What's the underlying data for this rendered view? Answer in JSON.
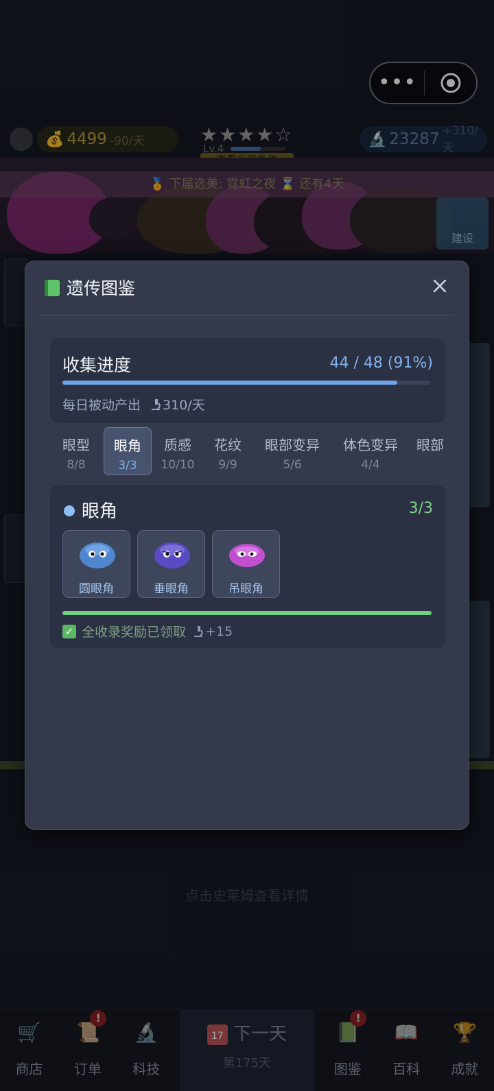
{
  "topbar": {
    "coins": "4499",
    "coins_rate": "-90/天",
    "stars": "★★★★☆",
    "level": "Lv.4",
    "upgrade_label": "查看升级条件",
    "research": "23287",
    "research_rate": "+310/天",
    "event_text": "🏅 下届选美: 霓虹之夜   ⌛ 还有4天",
    "build_label": "建设"
  },
  "hint": "点击史莱姆查看详情",
  "modal": {
    "title": "遗传图鉴",
    "progress": {
      "title": "收集进度",
      "count_text": "44 / 48 (91%)",
      "fraction": 0.91,
      "daily_label": "每日被动产出",
      "daily_value": "310/天"
    },
    "tabs": [
      {
        "label": "眼型",
        "count": "8/8",
        "active": false
      },
      {
        "label": "眼角",
        "count": "3/3",
        "active": true
      },
      {
        "label": "质感",
        "count": "10/10",
        "active": false
      },
      {
        "label": "花纹",
        "count": "9/9",
        "active": false
      },
      {
        "label": "眼部变异",
        "count": "5/6",
        "active": false
      },
      {
        "label": "体色变异",
        "count": "4/4",
        "active": false
      },
      {
        "label": "眼部",
        "count": "",
        "active": false
      }
    ],
    "category": {
      "name": "眼角",
      "count": "3/3",
      "entries": [
        {
          "label": "圆眼角",
          "color": "#4f86d0"
        },
        {
          "label": "垂眼角",
          "color": "#5a4bc4"
        },
        {
          "label": "吊眼角",
          "color": "#c04fd0"
        }
      ],
      "completion": 1.0,
      "reward_text": "全收录奖励已领取",
      "reward_bonus": "+15"
    }
  },
  "nav": {
    "items": [
      {
        "label": "商店",
        "badge": ""
      },
      {
        "label": "订单",
        "badge": "!"
      },
      {
        "label": "科技",
        "badge": ""
      },
      {
        "label": "图鉴",
        "badge": "!"
      },
      {
        "label": "百科",
        "badge": ""
      },
      {
        "label": "成就",
        "badge": ""
      }
    ],
    "next_day_label": "下一天",
    "day_counter": "第175天",
    "calendar_day": "17"
  },
  "colors": {
    "accent_blue": "#7fb1ef",
    "success_green": "#7ed38a",
    "modal_bg": "#343a4b",
    "card_bg": "#2b3142"
  }
}
